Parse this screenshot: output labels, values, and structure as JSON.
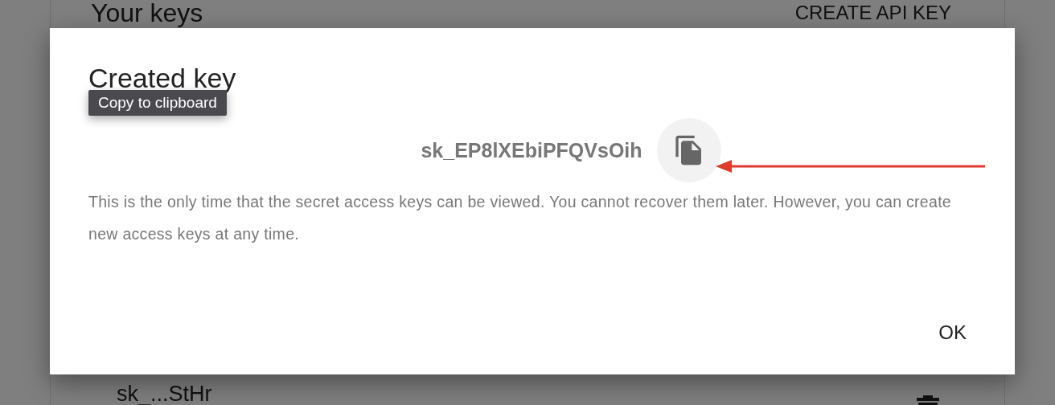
{
  "page": {
    "title": "Your keys",
    "create_button": "CREATE API KEY",
    "keys": [
      {
        "name": "sk_...StHr"
      }
    ]
  },
  "dialog": {
    "title": "Created key",
    "tooltip": "Copy to clipboard",
    "key": "sk_EP8lXEbiPFQVsOih",
    "message": "This is the only time that the secret access keys can be viewed. You cannot recover them later. However, you can create new access keys at any time.",
    "ok_button": "OK"
  }
}
